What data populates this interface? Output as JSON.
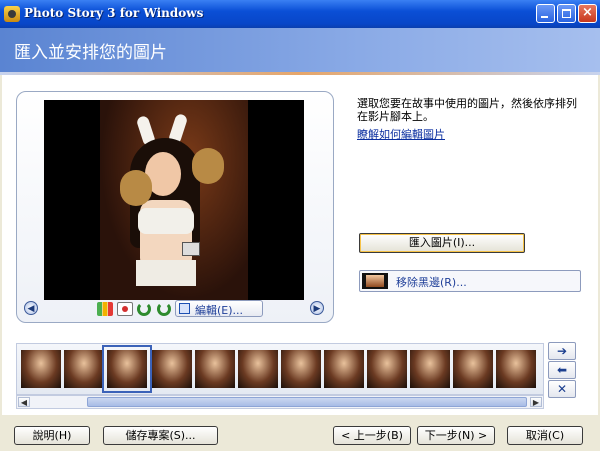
{
  "window": {
    "title": "Photo Story 3 for Windows"
  },
  "header": {
    "title": "匯入並安排您的圖片"
  },
  "preview": {
    "edit_label": "編輯(E)..."
  },
  "right_panel": {
    "instruction": "選取您要在故事中使用的圖片，然後依序排列在影片腳本上。",
    "help_link": "瞭解如何編輯圖片",
    "import_label": "匯入圖片(I)...",
    "remove_border_label": "移除黑邊(R)..."
  },
  "filmstrip": {
    "thumbnail_count": 12,
    "selected_index": 2
  },
  "bottom": {
    "help": "說明(H)",
    "save": "儲存專案(S)...",
    "back": "< 上一步(B)",
    "next": "下一步(N) >",
    "cancel": "取消(C)"
  },
  "icons": {
    "prev": "chevron-left-icon",
    "next": "chevron-right-icon",
    "move_right": "arrow-right-icon",
    "move_left": "arrow-left-icon",
    "delete": "x-icon"
  }
}
